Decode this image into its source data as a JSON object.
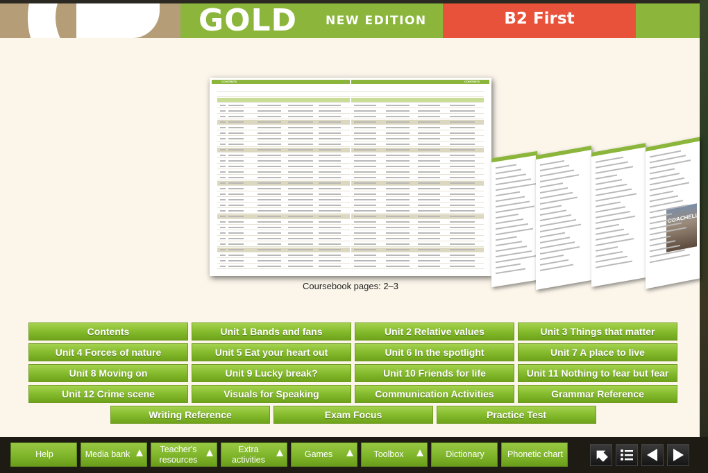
{
  "header": {
    "brand": "GOLD",
    "edition": "NEW EDITION",
    "level": "B2 First"
  },
  "preview": {
    "left_page_head": "CONTENTS",
    "right_page_head": "CONTENTS",
    "photo_text": "COACHELLA",
    "caption": "Coursebook pages: 2–3"
  },
  "units": [
    "Contents",
    "Unit 1 Bands and fans",
    "Unit 2 Relative values",
    "Unit 3 Things that matter",
    "Unit 4 Forces of nature",
    "Unit 5 Eat your heart out",
    "Unit 6 In the spotlight",
    "Unit 7 A place to live",
    "Unit 8 Moving on",
    "Unit 9 Lucky break?",
    "Unit 10 Friends for life",
    "Unit 11 Nothing to fear but fear",
    "Unit 12 Crime scene",
    "Visuals for Speaking",
    "Communication Activities",
    "Grammar Reference",
    "Writing Reference",
    "Exam Focus",
    "Practice Test"
  ],
  "toolbar": {
    "help": "Help",
    "media_bank": "Media bank",
    "teachers_resources_1": "Teacher's",
    "teachers_resources_2": "resources",
    "extra_activities_1": "Extra",
    "extra_activities_2": "activities",
    "games": "Games",
    "toolbox": "Toolbox",
    "dictionary": "Dictionary",
    "phonetic_chart": "Phonetic chart"
  },
  "nav_icons": [
    "home-icon",
    "list-icon",
    "previous-icon",
    "next-icon"
  ],
  "colors": {
    "brand_green": "#8bb63b",
    "level_red": "#e8523a",
    "logo_tan": "#b59d78",
    "content_bg": "#fbf5ea"
  }
}
